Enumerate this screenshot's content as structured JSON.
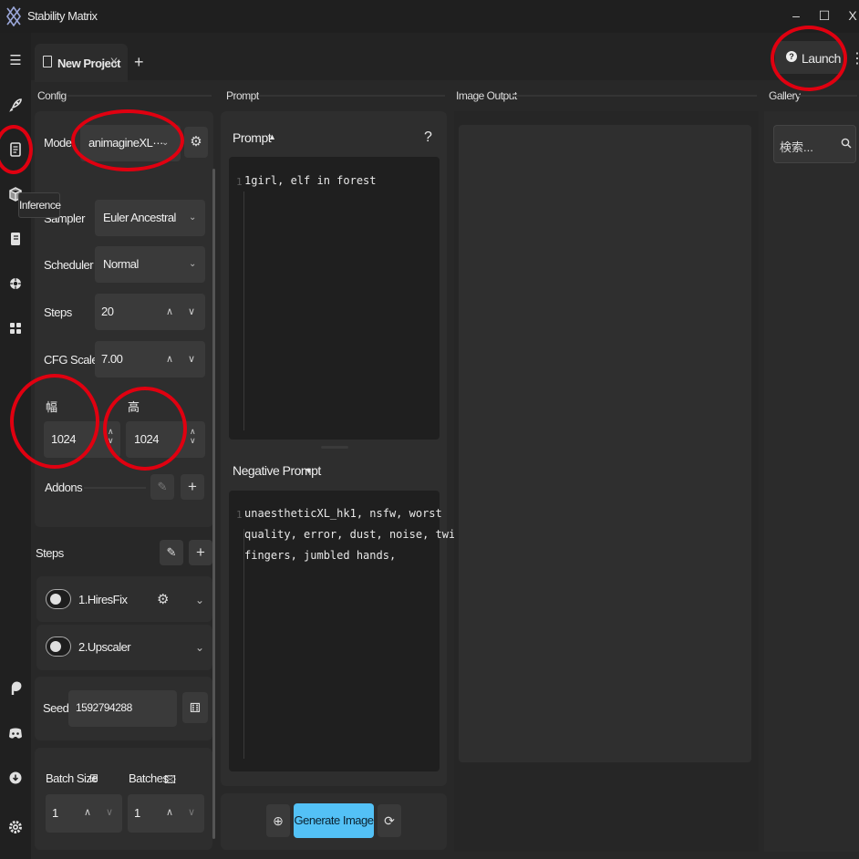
{
  "window": {
    "title": "Stability Matrix",
    "controls": {
      "minimize": "–",
      "maximize": "☐",
      "close": "X"
    }
  },
  "tabs": [
    {
      "label": "New Project",
      "close": "X"
    }
  ],
  "tab_add": "+",
  "launch": {
    "label": "Launch",
    "icon": "?"
  },
  "more": "⋮",
  "tooltip": "Inference",
  "sections": {
    "config": "Config",
    "prompt": "Prompt",
    "image_output": "Image Output",
    "gallery": "Gallery"
  },
  "config": {
    "model": {
      "label": "Model",
      "value": "animagineXL···"
    },
    "sampler": {
      "label": "Sampler",
      "value": "Euler Ancestral"
    },
    "scheduler": {
      "label": "Scheduler",
      "value": "Normal"
    },
    "steps": {
      "label": "Steps",
      "value": "20"
    },
    "cfg_scale": {
      "label": "CFG Scale",
      "value": "7.00"
    },
    "width": {
      "label": "幅",
      "value": "1024"
    },
    "height": {
      "label": "高",
      "value": "1024"
    },
    "addons": {
      "label": "Addons"
    }
  },
  "steps_section": {
    "title": "Steps",
    "items": [
      {
        "label": "1.HiresFix",
        "enabled": false
      },
      {
        "label": "2.Upscaler",
        "enabled": false
      }
    ]
  },
  "seed": {
    "label": "Seed",
    "value": "1592794288"
  },
  "batch": {
    "size_label": "Batch Size",
    "size_value": "1",
    "batches_label": "Batches",
    "batches_value": "1"
  },
  "prompt": {
    "title": "Prompt",
    "help": "?",
    "line_number": "1",
    "text": "1girl, elf in forest"
  },
  "negative_prompt": {
    "title": "Negative Prompt",
    "line_number": "1",
    "lines": [
      "unaestheticXL_hk1, nsfw, worst",
      "quality, error, dust, noise, twisted",
      "fingers, jumbled hands,"
    ]
  },
  "generate": {
    "label": "Generate Image"
  },
  "gallery_search": {
    "placeholder": "検索..."
  },
  "colors": {
    "accent": "#53c1f6",
    "annotation": "#e00010"
  },
  "icons": [
    "app-logo",
    "hamburger-icon",
    "rocket-icon",
    "inference-icon",
    "package-icon",
    "notebook-icon",
    "openart-icon",
    "extensions-icon",
    "patreon-icon",
    "discord-icon",
    "download-icon",
    "settings-icon",
    "search-icon",
    "gear-icon",
    "dice-icon",
    "pencil-icon",
    "plus-icon",
    "magnify-plus-icon",
    "refresh-icon",
    "grid-icon",
    "image-icon"
  ]
}
